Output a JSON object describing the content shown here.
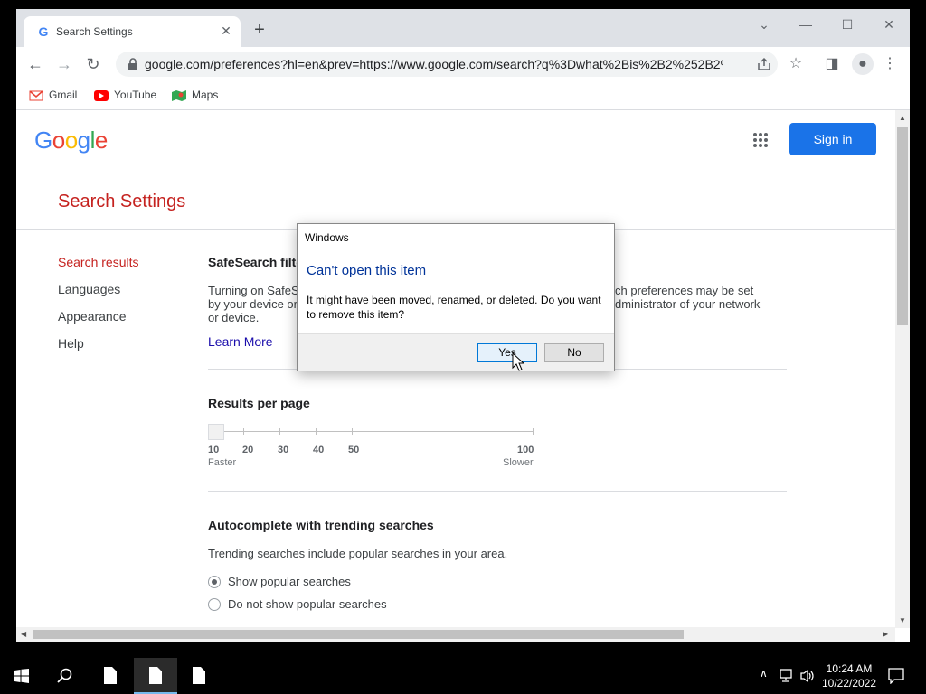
{
  "browser": {
    "tab_title": "Search Settings",
    "tab_favicon": "G",
    "new_tab_symbol": "+",
    "url": "google.com/preferences?hl=en&prev=https://www.google.com/search?q%3Dwhat%2Bis%2B2%252B2%2...",
    "bookmarks": [
      {
        "label": "Gmail",
        "icon": "gmail-icon"
      },
      {
        "label": "YouTube",
        "icon": "youtube-icon"
      },
      {
        "label": "Maps",
        "icon": "maps-icon"
      }
    ]
  },
  "page": {
    "logo": "Google",
    "sign_in": "Sign in",
    "title": "Search Settings",
    "sidebar": [
      {
        "label": "Search results",
        "active": true
      },
      {
        "label": "Languages",
        "active": false
      },
      {
        "label": "Appearance",
        "active": false
      },
      {
        "label": "Help",
        "active": false
      }
    ],
    "safesearch": {
      "heading": "SafeSearch filte",
      "text_left_1": "Turning on SafeS",
      "text_left_2": "by your device or",
      "text_left_3": "or device.",
      "text_right_1": "ch preferences may be set",
      "text_right_2": "dministrator of your network",
      "learn_more": "Learn More"
    },
    "results_per_page": {
      "heading": "Results per page",
      "ticks": [
        "10",
        "20",
        "30",
        "40",
        "50",
        "100"
      ],
      "faster": "Faster",
      "slower": "Slower",
      "selected": "10"
    },
    "autocomplete": {
      "heading": "Autocomplete with trending searches",
      "description": "Trending searches include popular searches in your area.",
      "options": [
        {
          "label": "Show popular searches",
          "checked": true
        },
        {
          "label": "Do not show popular searches",
          "checked": false
        }
      ]
    }
  },
  "dialog": {
    "caption": "Windows",
    "heading": "Can't open this item",
    "message": "It might have been moved, renamed, or deleted. Do you want to remove this item?",
    "yes": "Yes",
    "no": "No"
  },
  "taskbar": {
    "time": "10:24 AM",
    "date": "10/22/2022"
  },
  "colors": {
    "accent_red": "#c5221f",
    "sign_in_blue": "#1a73e8",
    "dialog_heading": "#003399"
  }
}
